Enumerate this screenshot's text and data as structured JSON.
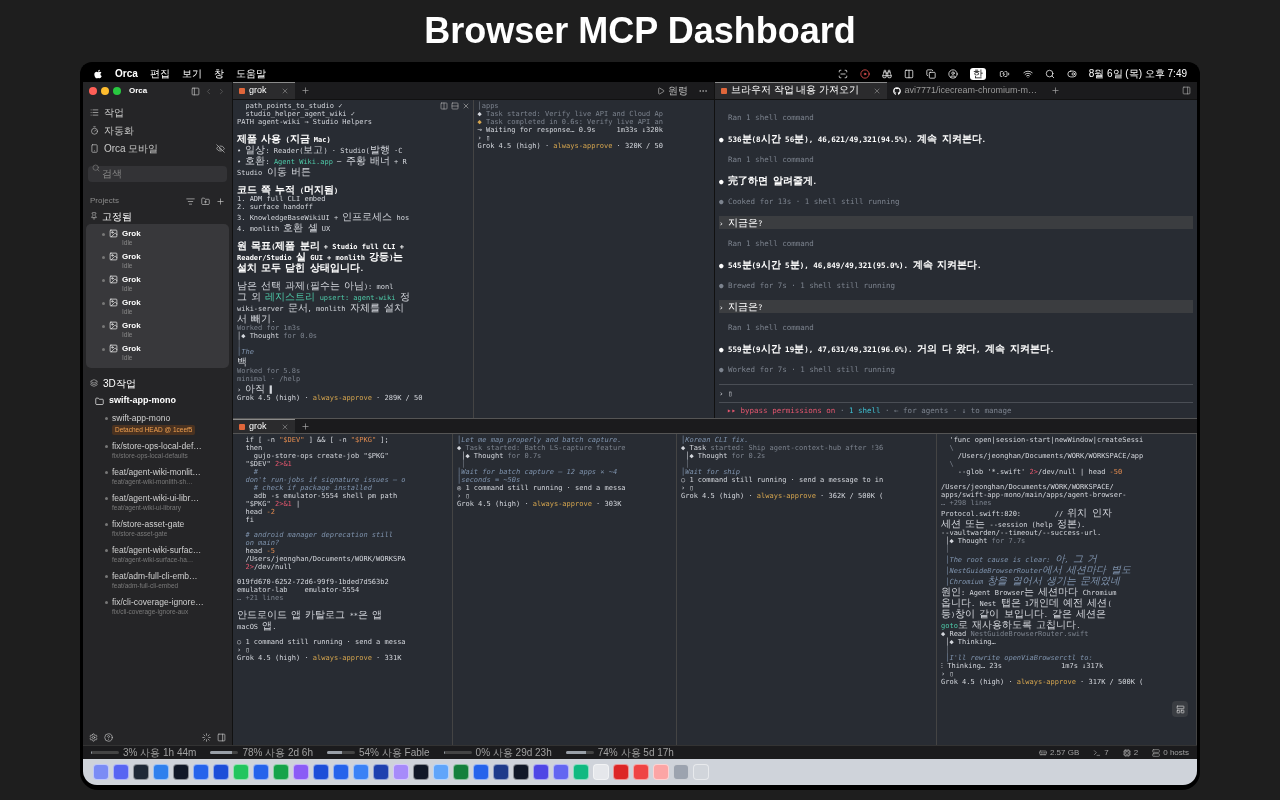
{
  "page_title": "Browser MCP Dashboard",
  "menu_bar": {
    "app": "Orca",
    "menus": [
      "편집",
      "보기",
      "창",
      "도움말"
    ],
    "input_source": "한",
    "clock": "8월 6일 (목) 오후 7:49"
  },
  "sidebar": {
    "app_name": "Orca",
    "nav": [
      {
        "label": "작업"
      },
      {
        "label": "자동화"
      },
      {
        "label": "Orca 모바일"
      }
    ],
    "search": {
      "placeholder": "검색"
    },
    "projects_label": "Projects",
    "pinned": {
      "label": "고정됨",
      "items": [
        {
          "title": "Grok",
          "status": "Idle"
        },
        {
          "title": "Grok",
          "status": "Idle"
        },
        {
          "title": "Grok",
          "status": "Idle"
        },
        {
          "title": "Grok",
          "status": "Idle"
        },
        {
          "title": "Grok",
          "status": "Idle"
        },
        {
          "title": "Grok",
          "status": "Idle"
        }
      ]
    },
    "group": {
      "label": "3D작업",
      "repo": "swift-app-mono",
      "worktrees": [
        {
          "title": "swift-app-mono",
          "badge": "Detached HEAD @ 1ceef5"
        },
        {
          "title": "fix/store-ops-local-def…",
          "branch": "fix/store-ops-local-defaults"
        },
        {
          "title": "feat/agent-wiki-monlit…",
          "branch": "feat/agent-wiki-monlith-sh…"
        },
        {
          "title": "feat/agent-wiki-ui-libr…",
          "branch": "feat/agent-wiki-ui-library"
        },
        {
          "title": "fix/store-asset-gate",
          "branch": "fix/store-asset-gate"
        },
        {
          "title": "feat/agent-wiki-surfac…",
          "branch": "feat/agent-wiki-surface-ha…"
        },
        {
          "title": "feat/adm-full-cli-emb…",
          "branch": "feat/adm-full-cli-embed"
        },
        {
          "title": "fix/cli-coverage-ignore…",
          "branch": "fix/cli-coverage-ignore-aux"
        }
      ]
    }
  },
  "top_tabs": [
    {
      "label": "grok",
      "selected": true
    }
  ],
  "run_label": "원령",
  "browser_tabs": [
    {
      "label": "브라우저 작업 내용 가져오기",
      "selected": true
    },
    {
      "label": "avi7771/icecream-chromium-m…",
      "selected": false
    }
  ],
  "top_left": {
    "lines": [
      {
        "text": "  path_points_to_studio ✓",
        "kind": "plain"
      },
      {
        "text": "  studio_helper_agent_wiki ✓",
        "kind": "plain"
      },
      {
        "text": "PATH agent-wiki → Studio Helpers",
        "kind": "plain"
      },
      {
        "text": "제품 사용 (지금 Mac)",
        "kind": "bold",
        "gap": true
      },
      {
        "text": "• 일상: Reader(보고) · Studio(발행 ·C",
        "kind": "plain"
      },
      {
        "parts": [
          {
            "text": "• 호환: ",
            "kind": "plain"
          },
          {
            "text": "Agent Wiki.app",
            "kind": "green"
          },
          {
            "text": " ─ 주황 배너 + R",
            "kind": "plain"
          }
        ]
      },
      {
        "text": "Studio 이동 버튼",
        "kind": "plain"
      },
      {
        "text": "코드 쪽 누적 (머지됨)",
        "kind": "bold",
        "gap": true
      },
      {
        "text": "1. ADM full CLI embed",
        "kind": "plain"
      },
      {
        "text": "2. surface handoff",
        "kind": "plain"
      },
      {
        "text": "3. KnowledgeBaseWikiUI + 인프로세스 hos",
        "kind": "plain"
      },
      {
        "text": "4. monlith 호환 셸 UX",
        "kind": "plain"
      },
      {
        "text": "원 목표(제품 분리 + Studio full CLI +",
        "kind": "bold",
        "gap": true
      },
      {
        "text": "Reader/Studio 실 GUI + monlith 강등)는",
        "kind": "bold"
      },
      {
        "text": "설치 모두 닫힌 상태입니다.",
        "kind": "bold"
      },
      {
        "text": "남은 선택 과제(필수는 아님): monl",
        "kind": "plain",
        "gap": true
      },
      {
        "parts": [
          {
            "text": "그 외 ",
            "kind": "plain"
          },
          {
            "text": "레지스트리 upsert: agent-wiki",
            "kind": "green"
          },
          {
            "text": " 정",
            "kind": "plain"
          }
        ]
      },
      {
        "text": "wiki-server 문서, monlith 자체를 설치",
        "kind": "plain"
      },
      {
        "text": "서 빼기.",
        "kind": "plain"
      },
      {
        "text": "Worked for 1m3s",
        "kind": "dim"
      },
      {
        "parts": [
          {
            "text": "│◆ Thought",
            "kind": "plain"
          },
          {
            "text": " for 0.0s",
            "kind": "dim"
          }
        ]
      },
      {
        "text": "│",
        "kind": "dim"
      },
      {
        "text": "│The",
        "kind": "comment"
      },
      {
        "text": "백",
        "kind": "plain"
      },
      {
        "text": "Worked for 5.8s",
        "kind": "dim"
      },
      {
        "text": "minimal · /help",
        "kind": "dim"
      },
      {
        "text": "› 아직 ▌",
        "kind": "plain"
      },
      {
        "parts": [
          {
            "text": "Grok 4.5 (high) · ",
            "kind": "plain"
          },
          {
            "text": "always-approve",
            "kind": "yellow"
          },
          {
            "text": " · 289K / 50",
            "kind": "plain"
          }
        ]
      }
    ]
  },
  "top_middle": {
    "lines": [
      {
        "text": "│apps",
        "kind": "dim"
      },
      {
        "parts": [
          {
            "text": "◆ ",
            "kind": "plain"
          },
          {
            "text": "Task started: Verify live API and Cloud Ap",
            "kind": "dim"
          }
        ]
      },
      {
        "parts": [
          {
            "text": "◆ ",
            "kind": "yellow"
          },
          {
            "text": "Task completed in 0.6s: Verify live API an",
            "kind": "dim"
          }
        ]
      },
      {
        "text": "⊸ Waiting for response… 0.9s     1m33s ↓320k",
        "kind": "plain"
      },
      {
        "text": "› ▯",
        "kind": "plain"
      },
      {
        "parts": [
          {
            "text": "Grok 4.5 (high) · ",
            "kind": "plain"
          },
          {
            "text": "always-approve",
            "kind": "yellow"
          },
          {
            "text": " · 320K / 50",
            "kind": "plain"
          }
        ]
      }
    ]
  },
  "agent_pane": {
    "lines": [
      {
        "text": "  Ran 1 shell command",
        "kind": "dim"
      },
      {
        "text": "● 536분(8시간 56분), 46,621/49,321(94.5%). 계속 지켜본다.",
        "kind": "bold"
      },
      {
        "text": "  Ran 1 shell command",
        "kind": "dim"
      },
      {
        "text": "● 完了하면 알려줄게.",
        "kind": "bold"
      },
      {
        "text": "● Cooked for 13s · 1 shell still running",
        "kind": "dim"
      },
      {
        "text": "› 지금은?",
        "kind": "highlight"
      },
      {
        "text": "  Ran 1 shell command",
        "kind": "dim"
      },
      {
        "text": "● 545분(9시간 5분), 46,849/49,321(95.0%). 계속 지켜본다.",
        "kind": "bold"
      },
      {
        "text": "● Brewed for 7s · 1 shell still running",
        "kind": "dim"
      },
      {
        "text": "› 지금은?",
        "kind": "highlight"
      },
      {
        "text": "  Ran 1 shell command",
        "kind": "dim"
      },
      {
        "text": "● 559분(9시간 19분), 47,631/49,321(96.6%). 거의 다 왔다, 계속 지켜본다.",
        "kind": "bold"
      },
      {
        "text": "● Worked for 7s · 1 shell still running",
        "kind": "dim"
      }
    ],
    "input": "› ▯",
    "footer": [
      {
        "text": "▸▸ bypass permissions on",
        "kind": "red"
      },
      {
        "text": " · ",
        "kind": "dim"
      },
      {
        "text": "1 shell",
        "kind": "cyan"
      },
      {
        "text": " · ← for agents · ↓ to manage",
        "kind": "dim"
      }
    ]
  },
  "bottom_tabs": [
    {
      "label": "grok",
      "selected": true
    }
  ],
  "bottom_panes": [
    {
      "lines": [
        {
          "parts": [
            {
              "text": "  if [ -n ",
              "kind": "plain"
            },
            {
              "text": "\"$DEV\"",
              "kind": "orange"
            },
            {
              "text": " ] && [ -n ",
              "kind": "plain"
            },
            {
              "text": "\"$PKG\"",
              "kind": "orange"
            },
            {
              "text": " ];",
              "kind": "plain"
            }
          ]
        },
        {
          "text": "  then",
          "kind": "plain"
        },
        {
          "text": "    gujo-store-ops create-job \"$PKG\"",
          "kind": "plain"
        },
        {
          "parts": [
            {
              "text": "  \"$DEV\" ",
              "kind": "plain"
            },
            {
              "text": "2>&1",
              "kind": "red"
            }
          ]
        },
        {
          "text": "    #",
          "kind": "comment"
        },
        {
          "text": "  don't run-jobs if signature issues — o",
          "kind": "comment"
        },
        {
          "text": "    # check if package installed",
          "kind": "comment"
        },
        {
          "text": "    adb -s emulator-5554 shell pm path",
          "kind": "plain"
        },
        {
          "parts": [
            {
              "text": "  \"$PKG\" ",
              "kind": "plain"
            },
            {
              "text": "2>&1",
              "kind": "red"
            },
            {
              "text": " |",
              "kind": "plain"
            }
          ]
        },
        {
          "parts": [
            {
              "text": "  head ",
              "kind": "plain"
            },
            {
              "text": "-2",
              "kind": "orange"
            }
          ]
        },
        {
          "text": "  fi",
          "kind": "plain"
        },
        {
          "text": "  # android manager deprecation still",
          "kind": "comment",
          "gap": true
        },
        {
          "text": "  on main?",
          "kind": "comment"
        },
        {
          "parts": [
            {
              "text": "  head ",
              "kind": "plain"
            },
            {
              "text": "-5",
              "kind": "orange"
            }
          ]
        },
        {
          "text": "  /Users/jeonghan/Documents/WORK/WORKSPA",
          "kind": "plain"
        },
        {
          "parts": [
            {
              "text": "  2>",
              "kind": "red"
            },
            {
              "text": "/dev/null",
              "kind": "plain"
            }
          ]
        },
        {
          "text": "019fd670-6252-72d6-99f9-1bded7d563b2",
          "kind": "plain",
          "gap": true
        },
        {
          "text": "emulator-lab    emulator-5554",
          "kind": "plain"
        },
        {
          "text": "… +21 lines",
          "kind": "dim"
        },
        {
          "text": "안드로이드 앱 카탈로그 **은 앱",
          "kind": "plain",
          "gap": true
        },
        {
          "text": "macOS 앱.",
          "kind": "plain"
        },
        {
          "text": "○ 1 command still running · send a messa",
          "kind": "plain",
          "gap": true
        },
        {
          "text": "› ▯",
          "kind": "plain"
        },
        {
          "parts": [
            {
              "text": "Grok 4.5 (high) · ",
              "kind": "plain"
            },
            {
              "text": "always-approve",
              "kind": "yellow"
            },
            {
              "text": " · 331K",
              "kind": "plain"
            }
          ]
        }
      ]
    },
    {
      "lines": [
        {
          "text": "│Let me map properly and batch capture.",
          "kind": "comment"
        },
        {
          "parts": [
            {
              "text": "◆ ",
              "kind": "plain"
            },
            {
              "text": "Task started: Batch LS-capture feature",
              "kind": "dim"
            }
          ]
        },
        {
          "parts": [
            {
              "text": " │◆ Thought",
              "kind": "plain"
            },
            {
              "text": " for 0.7s",
              "kind": "dim"
            }
          ]
        },
        {
          "text": " │",
          "kind": "dim"
        },
        {
          "text": "│Wait for batch capture — 12 apps × ~4",
          "kind": "comment"
        },
        {
          "text": "│seconds = ~50s",
          "kind": "comment"
        },
        {
          "text": "◎ 1 command still running · send a messa",
          "kind": "plain"
        },
        {
          "text": "› ▯",
          "kind": "plain"
        },
        {
          "parts": [
            {
              "text": "Grok 4.5 (high) · ",
              "kind": "plain"
            },
            {
              "text": "always-approve",
              "kind": "yellow"
            },
            {
              "text": " · 303K",
              "kind": "plain"
            }
          ]
        }
      ]
    },
    {
      "lines": [
        {
          "text": "│Korean CLI fix.",
          "kind": "comment"
        },
        {
          "parts": [
            {
              "text": "◆ Task",
              "kind": "plain"
            },
            {
              "text": " started: Ship agent-context-hub after !36",
              "kind": "dim"
            }
          ]
        },
        {
          "parts": [
            {
              "text": " │◆ Thought",
              "kind": "plain"
            },
            {
              "text": " for 0.2s",
              "kind": "dim"
            }
          ]
        },
        {
          "text": " │",
          "kind": "dim"
        },
        {
          "text": "│Wait for ship",
          "kind": "comment"
        },
        {
          "text": "○ 1 command still running · send a message to in",
          "kind": "plain"
        },
        {
          "text": "› ▯",
          "kind": "plain"
        },
        {
          "parts": [
            {
              "text": "Grok 4.5 (high) · ",
              "kind": "plain"
            },
            {
              "text": "always-approve",
              "kind": "yellow"
            },
            {
              "text": " · 362K / 500K (",
              "kind": "plain"
            }
          ]
        }
      ]
    },
    {
      "lines": [
        {
          "text": "  'func open|session-start|newWindow|createSessi",
          "kind": "plain"
        },
        {
          "text": "  \\",
          "kind": "dim"
        },
        {
          "text": "    /Users/jeonghan/Documents/WORK/WORKSPACE/app",
          "kind": "plain"
        },
        {
          "text": "  \\",
          "kind": "dim"
        },
        {
          "parts": [
            {
              "text": "    --glob '*.swift' ",
              "kind": "plain"
            },
            {
              "text": "2>",
              "kind": "red"
            },
            {
              "text": "/dev/null | head ",
              "kind": "plain"
            },
            {
              "text": "-50",
              "kind": "orange"
            }
          ]
        },
        {
          "text": "/Users/jeonghan/Documents/WORK/WORKSPACE/",
          "kind": "plain",
          "gap": true
        },
        {
          "text": "apps/swift-app-mono/main/apps/agent-browser-",
          "kind": "plain"
        },
        {
          "text": "… +298 lines",
          "kind": "dim"
        },
        {
          "text": "Protocol.swift:820:        // 위치 인자",
          "kind": "plain"
        },
        {
          "text": "세션 또는 --session (help 정본).",
          "kind": "plain"
        },
        {
          "text": "--vaultwarden/--timeout/--success-url.",
          "kind": "plain"
        },
        {
          "parts": [
            {
              "text": " │◆ Thought",
              "kind": "plain"
            },
            {
              "text": " for 7.7s",
              "kind": "dim"
            }
          ]
        },
        {
          "text": " │",
          "kind": "dim"
        },
        {
          "text": " │The root cause is clear: 아, 그 거",
          "kind": "comment"
        },
        {
          "text": " │NestGuideBrowserRouter에서 세션마다 별도",
          "kind": "comment"
        },
        {
          "text": " │Chromium 창을 열어서 생기는 문제였네",
          "kind": "comment"
        },
        {
          "text": "원인: Agent Browser는 세션마다 Chromium",
          "kind": "plain"
        },
        {
          "text": "옵니다. Nest 탭은 1개인데 예전 세션(",
          "kind": "plain"
        },
        {
          "text": "등)창이 같이 보입니다. 같은 세션은",
          "kind": "plain"
        },
        {
          "parts": [
            {
              "text": "goto",
              "kind": "green"
            },
            {
              "text": "로 재사용하도록 고칩니다.",
              "kind": "plain"
            }
          ]
        },
        {
          "parts": [
            {
              "text": "◆ Read ",
              "kind": "plain"
            },
            {
              "text": "NestGuideBrowserRouter.swift",
              "kind": "dim"
            }
          ]
        },
        {
          "text": " │◆ Thinking…",
          "kind": "plain"
        },
        {
          "text": " │",
          "kind": "dim"
        },
        {
          "text": " │I'll rewrite openViaBrowserctl to:",
          "kind": "comment"
        },
        {
          "text": "⁝ Thinking… 23s              1m7s ↓317k",
          "kind": "plain"
        },
        {
          "text": "› ▯",
          "kind": "plain"
        },
        {
          "parts": [
            {
              "text": "Grok 4.5 (high) · ",
              "kind": "plain"
            },
            {
              "text": "always-approve",
              "kind": "yellow"
            },
            {
              "text": " · 317K / 500K (",
              "kind": "plain"
            }
          ]
        }
      ]
    }
  ],
  "status_bar": {
    "usage": [
      {
        "label": "3% 사용 1h 44m",
        "level": 0.03
      },
      {
        "label": "78% 사용 2d 6h",
        "level": 0.78
      },
      {
        "label": "54% 사용 Fable",
        "level": 0.54
      },
      {
        "label": "0% 사용 29d 23h",
        "level": 0
      },
      {
        "label": "74% 사용 5d 17h",
        "level": 0.74
      }
    ],
    "resources": [
      "2.57 GB",
      "7",
      "2",
      "0 hosts"
    ]
  }
}
